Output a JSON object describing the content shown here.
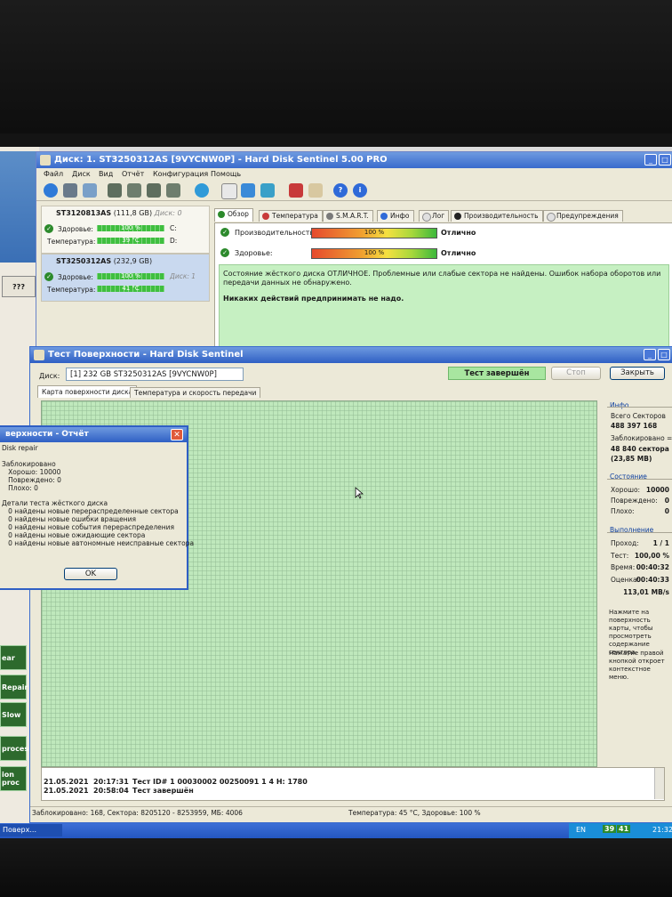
{
  "main_window": {
    "title": "Диск: 1. ST3250312AS [9VYCNW0P]  -  Hard Disk Sentinel 5.00 PRO",
    "menu": [
      "Файл",
      "Диск",
      "Вид",
      "Отчёт",
      "Конфигурация",
      "Помощь"
    ],
    "toolbar_icons": [
      "refresh-icon",
      "disk-icon",
      "chart-icon",
      "tool-icon",
      "tool-icon",
      "tool-icon",
      "tool-icon",
      "globe-icon",
      "document-icon",
      "sync-icon",
      "network-icon",
      "report-icon",
      "mail-icon",
      "help-icon",
      "info-icon"
    ]
  },
  "disks": [
    {
      "name": "ST3120813AS",
      "size": "(111,8 GB)",
      "disk_no": "Диск: 0",
      "health_label": "Здоровье:",
      "health_value": "100 %",
      "health_fraction": 1.0,
      "drive": "C:",
      "temp_label": "Температура:",
      "temp_value": "39 °C",
      "temp_drive": "D:"
    },
    {
      "name": "ST3250312AS",
      "size": "(232,9 GB)",
      "disk_no": "Диск: 1",
      "health_label": "Здоровье:",
      "health_value": "100 %",
      "health_fraction": 1.0,
      "temp_label": "Температура:",
      "temp_value": "41 °C"
    }
  ],
  "tabs": [
    "Обзор",
    "Температура",
    "S.M.A.R.T.",
    "Инфо",
    "Лог",
    "Производительность",
    "Предупреждения"
  ],
  "overview": {
    "perf_label": "Производительность:",
    "perf_value": "100 %",
    "perf_status": "Отлично",
    "health_label": "Здоровье:",
    "health_value": "100 %",
    "health_status": "Отлично",
    "status_text": "Состояние жёсткого диска ОТЛИЧНОЕ. Проблемные или слабые сектора не найдены. Ошибок набора оборотов или передачи данных не обнаружено.",
    "advice": "Никаких действий предпринимать не надо."
  },
  "surface_window": {
    "title": "Тест Поверхности - Hard Disk Sentinel",
    "disk_label": "Диск:",
    "disk_value": "[1] 232 GB  ST3250312AS [9VYCNW0P]",
    "status_badge": "Тест завершён",
    "stop_button": "Стоп",
    "close_button": "Закрыть",
    "tabs": [
      "Карта поверхности диска",
      "Температура и скорость передачи"
    ],
    "info_heading": "Инфо",
    "total_sectors_label": "Всего Секторов",
    "total_sectors": "488 397 168",
    "blocked_label": "Заблокировано =",
    "blocked_sectors": "48 840 сектора",
    "blocked_size": "(23,85 МВ)",
    "state_heading": "Состояние",
    "good_label": "Хорошо:",
    "good_value": "10000",
    "damaged_label": "Повреждено:",
    "damaged_value": "0",
    "bad_label": "Плохо:",
    "bad_value": "0",
    "progress_heading": "Выполнение",
    "pass_label": "Проход:",
    "pass_value": "1 / 1",
    "test_label": "Тест:",
    "test_value": "100,00 %",
    "time_label": "Время:",
    "time_value": "00:40:32",
    "estimate_label": "Оценка:",
    "estimate_value": "00:40:33",
    "speed_value": "113,01 MB/s",
    "hint1": "Нажмите на поверхность карты, чтобы просмотреть содержание сектора.",
    "hint2": "Нажатие правой кнопкой откроет контекстное меню.",
    "log": [
      {
        "date": "21.05.2021",
        "time": "20:17:31",
        "text": "Тест ID# 1 00030002 00250091 1 4 H: 1780"
      },
      {
        "date": "21.05.2021",
        "time": "20:58:04",
        "text": "Тест завершён"
      }
    ],
    "status_left": "Заблокировано: 168, Сектора: 8205120 - 8253959, МБ: 4006",
    "status_right": "Температура: 45 °C, Здоровье: 100 %"
  },
  "report_dialog": {
    "title": "верхности - Отчёт",
    "body": "Disk repair\n\nЗаблокировано\n   Хорошо: 10000\n   Повреждено: 0\n   Плохо: 0\n\nДетали теста жёсткого диска\n   0 найдены новые перераспределенные сектора\n   0 найдены новые ошибки вращения\n   0 найдены новые события перераспределения\n   0 найдены новые ожидающие сектора\n   0 найдены новые автономные неисправные сектора",
    "ok_button": "OK"
  },
  "background_app": {
    "button_q": "???",
    "buttons": [
      "ear",
      "Repair",
      "Slow",
      "proces:",
      "ion proc"
    ]
  },
  "taskbar": {
    "item": "Поверх...",
    "lang": "EN",
    "tray_temp": "39",
    "tray_health": "41",
    "clock": "21:32"
  },
  "colors": {
    "titlebar": "#3a6bcc",
    "status_green": "#c6f0c2",
    "surface_green": "#bfe8bc",
    "ok_green": "#2c8a2c"
  }
}
